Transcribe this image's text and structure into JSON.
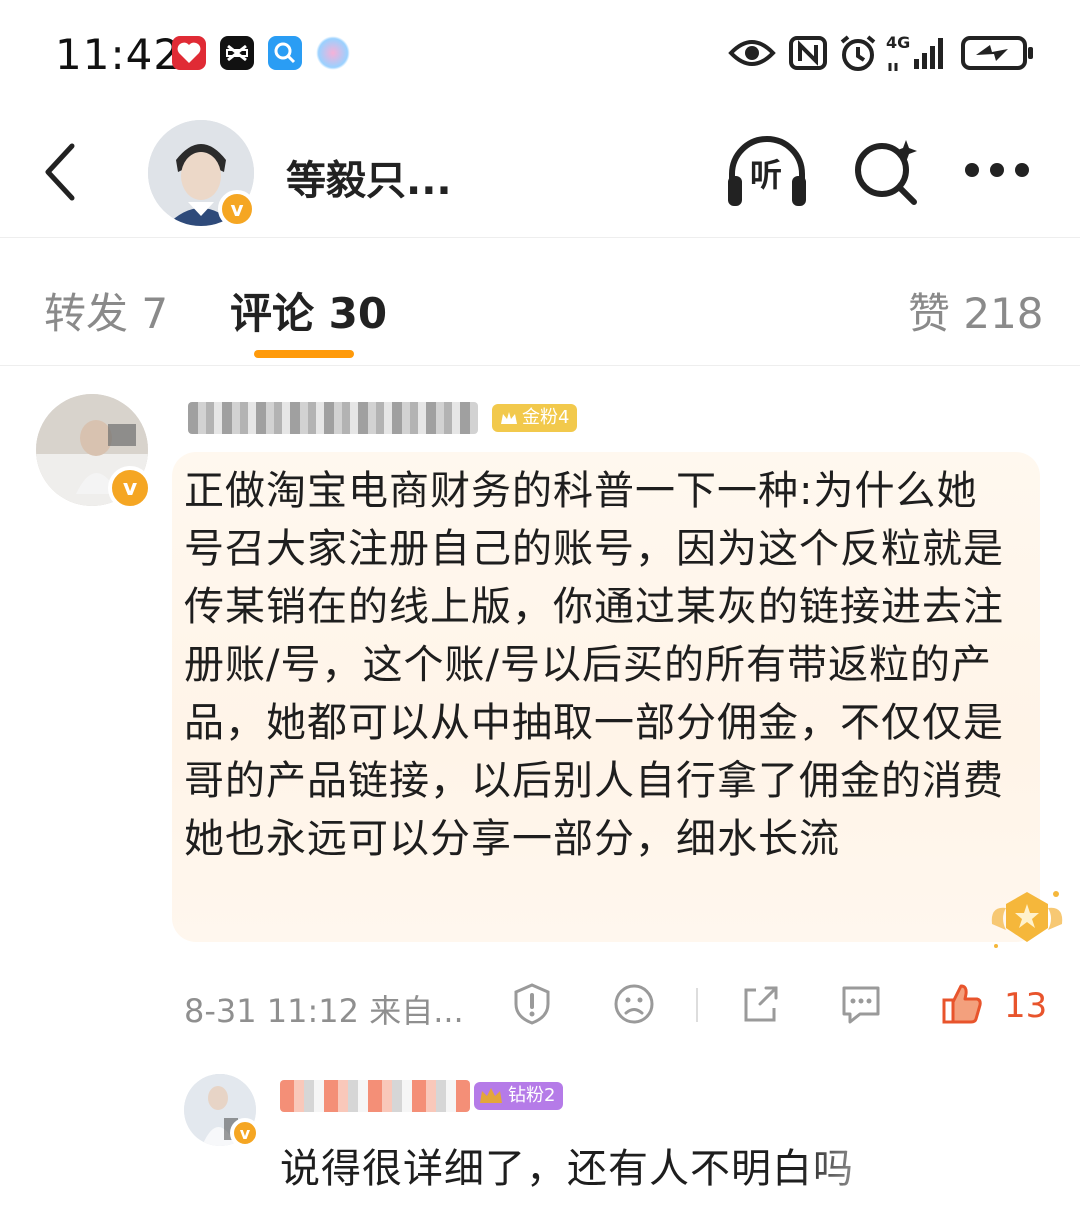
{
  "status_bar": {
    "time": "11:42",
    "network": "4G",
    "apps": [
      "heart-app-icon",
      "capcut-icon",
      "search-app-icon",
      "ai-app-icon"
    ]
  },
  "header": {
    "title": "等毅只...",
    "listen_label": "听"
  },
  "tabs": {
    "repost": "转发 7",
    "comment": "评论 30",
    "like": "赞 218",
    "active_color": "#ff9a0a"
  },
  "comment": {
    "fan_badge": "金粉4",
    "text": "正做淘宝电商财务的科普一下一种:为什么她号召大家注册自己的账号，因为这个反粒就是传某销在的线上版，你通过某灰的链接进去注册账/号，这个账/号以后买的所有带返粒的产品，她都可以从中抽取一部分佣金，不仅仅是哥的产品链接，以后别人自行拿了佣金的消费她也永远可以分享一部分，细水长流",
    "timestamp": "8-31 11:12 来自...",
    "like_count": "13",
    "like_color": "#e8542c"
  },
  "reply": {
    "fan_badge": "钻粉2",
    "text": "说得很详细了，还有人不明白吗"
  }
}
